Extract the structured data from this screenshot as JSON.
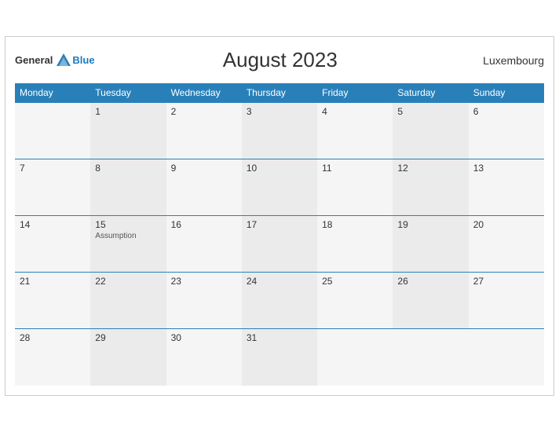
{
  "header": {
    "title": "August 2023",
    "country": "Luxembourg",
    "logo_general": "General",
    "logo_blue": "Blue"
  },
  "weekdays": [
    "Monday",
    "Tuesday",
    "Wednesday",
    "Thursday",
    "Friday",
    "Saturday",
    "Sunday"
  ],
  "weeks": [
    [
      {
        "day": "",
        "holiday": ""
      },
      {
        "day": "1",
        "holiday": ""
      },
      {
        "day": "2",
        "holiday": ""
      },
      {
        "day": "3",
        "holiday": ""
      },
      {
        "day": "4",
        "holiday": ""
      },
      {
        "day": "5",
        "holiday": ""
      },
      {
        "day": "6",
        "holiday": ""
      }
    ],
    [
      {
        "day": "7",
        "holiday": ""
      },
      {
        "day": "8",
        "holiday": ""
      },
      {
        "day": "9",
        "holiday": ""
      },
      {
        "day": "10",
        "holiday": ""
      },
      {
        "day": "11",
        "holiday": ""
      },
      {
        "day": "12",
        "holiday": ""
      },
      {
        "day": "13",
        "holiday": ""
      }
    ],
    [
      {
        "day": "14",
        "holiday": ""
      },
      {
        "day": "15",
        "holiday": "Assumption"
      },
      {
        "day": "16",
        "holiday": ""
      },
      {
        "day": "17",
        "holiday": ""
      },
      {
        "day": "18",
        "holiday": ""
      },
      {
        "day": "19",
        "holiday": ""
      },
      {
        "day": "20",
        "holiday": ""
      }
    ],
    [
      {
        "day": "21",
        "holiday": ""
      },
      {
        "day": "22",
        "holiday": ""
      },
      {
        "day": "23",
        "holiday": ""
      },
      {
        "day": "24",
        "holiday": ""
      },
      {
        "day": "25",
        "holiday": ""
      },
      {
        "day": "26",
        "holiday": ""
      },
      {
        "day": "27",
        "holiday": ""
      }
    ],
    [
      {
        "day": "28",
        "holiday": ""
      },
      {
        "day": "29",
        "holiday": ""
      },
      {
        "day": "30",
        "holiday": ""
      },
      {
        "day": "31",
        "holiday": ""
      },
      {
        "day": "",
        "holiday": ""
      },
      {
        "day": "",
        "holiday": ""
      },
      {
        "day": "",
        "holiday": ""
      }
    ]
  ]
}
